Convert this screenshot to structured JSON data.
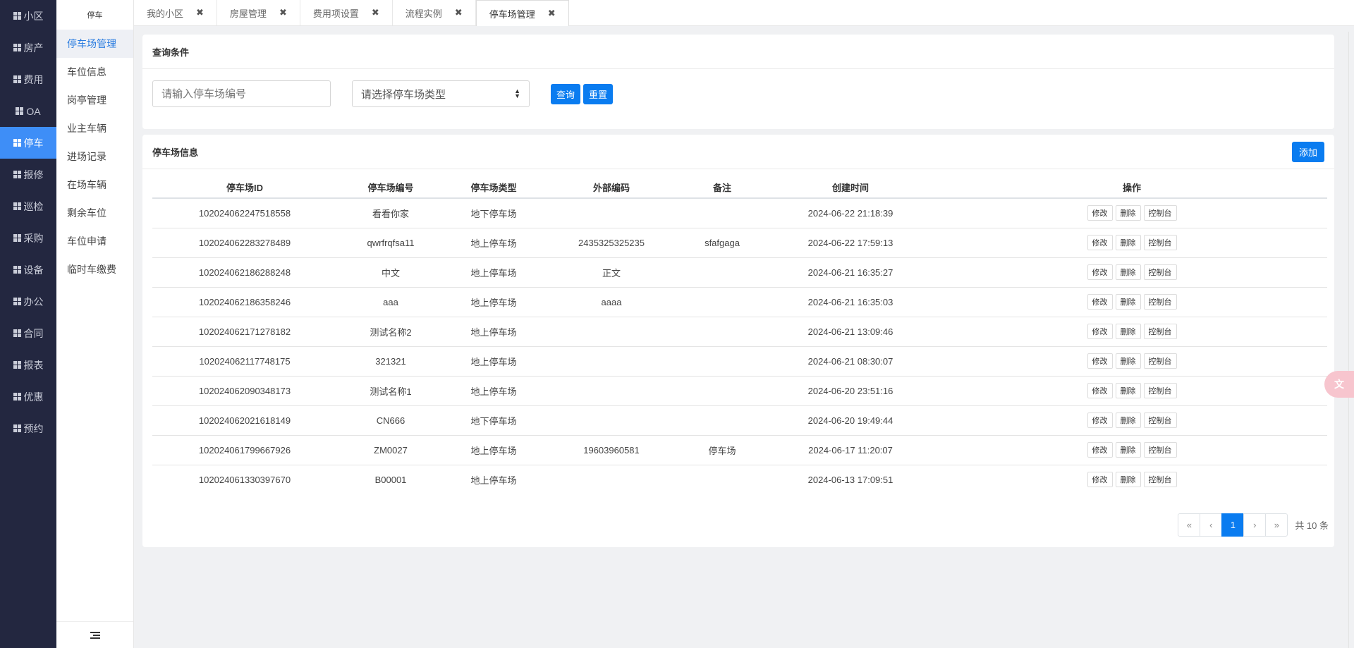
{
  "main_nav": [
    {
      "label": "小区",
      "active": false
    },
    {
      "label": "房产",
      "active": false
    },
    {
      "label": "费用",
      "active": false
    },
    {
      "label": "OA",
      "active": false
    },
    {
      "label": "停车",
      "active": true
    },
    {
      "label": "报修",
      "active": false
    },
    {
      "label": "巡检",
      "active": false
    },
    {
      "label": "采购",
      "active": false
    },
    {
      "label": "设备",
      "active": false
    },
    {
      "label": "办公",
      "active": false
    },
    {
      "label": "合同",
      "active": false
    },
    {
      "label": "报表",
      "active": false
    },
    {
      "label": "优惠",
      "active": false
    },
    {
      "label": "预约",
      "active": false
    }
  ],
  "sub_nav": {
    "title": "停车",
    "items": [
      {
        "label": "停车场管理",
        "active": true
      },
      {
        "label": "车位信息",
        "active": false
      },
      {
        "label": "岗亭管理",
        "active": false
      },
      {
        "label": "业主车辆",
        "active": false
      },
      {
        "label": "进场记录",
        "active": false
      },
      {
        "label": "在场车辆",
        "active": false
      },
      {
        "label": "剩余车位",
        "active": false
      },
      {
        "label": "车位申请",
        "active": false
      },
      {
        "label": "临时车缴费",
        "active": false
      }
    ]
  },
  "tabs": [
    {
      "label": "我的小区",
      "active": false
    },
    {
      "label": "房屋管理",
      "active": false
    },
    {
      "label": "费用项设置",
      "active": false
    },
    {
      "label": "流程实例",
      "active": false
    },
    {
      "label": "停车场管理",
      "active": true
    }
  ],
  "search": {
    "title": "查询条件",
    "code_placeholder": "请输入停车场编号",
    "type_select": "请选择停车场类型",
    "query_label": "查询",
    "reset_label": "重置"
  },
  "table": {
    "title": "停车场信息",
    "add_label": "添加",
    "columns": [
      "停车场ID",
      "停车场编号",
      "停车场类型",
      "外部编码",
      "备注",
      "创建时间",
      "操作"
    ],
    "op_labels": {
      "edit": "修改",
      "delete": "删除",
      "console": "控制台"
    },
    "rows": [
      {
        "id": "102024062247518558",
        "code": "看看你家",
        "type": "地下停车场",
        "ext": "",
        "remark": "",
        "created": "2024-06-22 21:18:39"
      },
      {
        "id": "102024062283278489",
        "code": "qwrfrqfsa11",
        "type": "地上停车场",
        "ext": "2435325325235",
        "remark": "sfafgaga",
        "created": "2024-06-22 17:59:13"
      },
      {
        "id": "102024062186288248",
        "code": "中文",
        "type": "地上停车场",
        "ext": "正文",
        "remark": "",
        "created": "2024-06-21 16:35:27"
      },
      {
        "id": "102024062186358246",
        "code": "aaa",
        "type": "地上停车场",
        "ext": "aaaa",
        "remark": "",
        "created": "2024-06-21 16:35:03"
      },
      {
        "id": "102024062171278182",
        "code": "测试名称2",
        "type": "地上停车场",
        "ext": "",
        "remark": "",
        "created": "2024-06-21 13:09:46"
      },
      {
        "id": "102024062117748175",
        "code": "321321",
        "type": "地上停车场",
        "ext": "",
        "remark": "",
        "created": "2024-06-21 08:30:07"
      },
      {
        "id": "102024062090348173",
        "code": "测试名称1",
        "type": "地上停车场",
        "ext": "",
        "remark": "",
        "created": "2024-06-20 23:51:16"
      },
      {
        "id": "102024062021618149",
        "code": "CN666",
        "type": "地下停车场",
        "ext": "",
        "remark": "",
        "created": "2024-06-20 19:49:44"
      },
      {
        "id": "102024061799667926",
        "code": "ZM0027",
        "type": "地上停车场",
        "ext": "19603960581",
        "remark": "停车场",
        "created": "2024-06-17 11:20:07"
      },
      {
        "id": "102024061330397670",
        "code": "B00001",
        "type": "地上停车场",
        "ext": "",
        "remark": "",
        "created": "2024-06-13 17:09:51"
      }
    ]
  },
  "pagination": {
    "first": "«",
    "prev": "‹",
    "current": "1",
    "next": "›",
    "last": "»",
    "total": "共 10 条"
  },
  "colors": {
    "accent": "#0a7cf0",
    "sidebar_bg": "#232740",
    "active_nav": "#3e8ef7"
  }
}
